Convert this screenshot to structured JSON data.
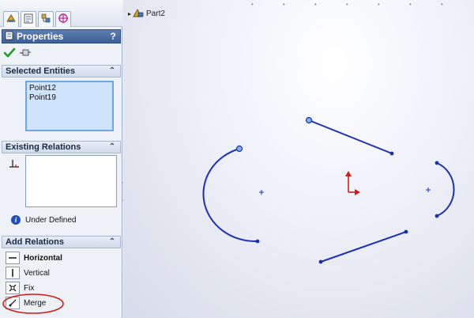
{
  "panel": {
    "tabs": [
      {
        "icon": "feature-manager-icon"
      },
      {
        "icon": "property-manager-icon"
      },
      {
        "icon": "configuration-manager-icon"
      },
      {
        "icon": "dimxpert-manager-icon"
      }
    ],
    "title": "Properties",
    "help_label": "?",
    "ok_icon": "checkmark-icon",
    "pin_icon": "pushpin-icon",
    "selected_entities": {
      "title": "Selected Entities",
      "items": [
        "Point12",
        "Point19"
      ]
    },
    "existing_relations": {
      "title": "Existing Relations",
      "status": "Under Defined"
    },
    "add_relations": {
      "title": "Add Relations",
      "items": [
        {
          "label": "Horizontal",
          "icon": "horizontal-relation-icon"
        },
        {
          "label": "Vertical",
          "icon": "vertical-relation-icon"
        },
        {
          "label": "Fix",
          "icon": "fix-relation-icon"
        },
        {
          "label": "Merge",
          "icon": "merge-relation-icon"
        }
      ]
    }
  },
  "viewport": {
    "tree_root_label": "Part2",
    "highlight_color": "#d11b1b",
    "sketch_color": "#1b2fb8",
    "point_fill": "#7fb3e6"
  }
}
